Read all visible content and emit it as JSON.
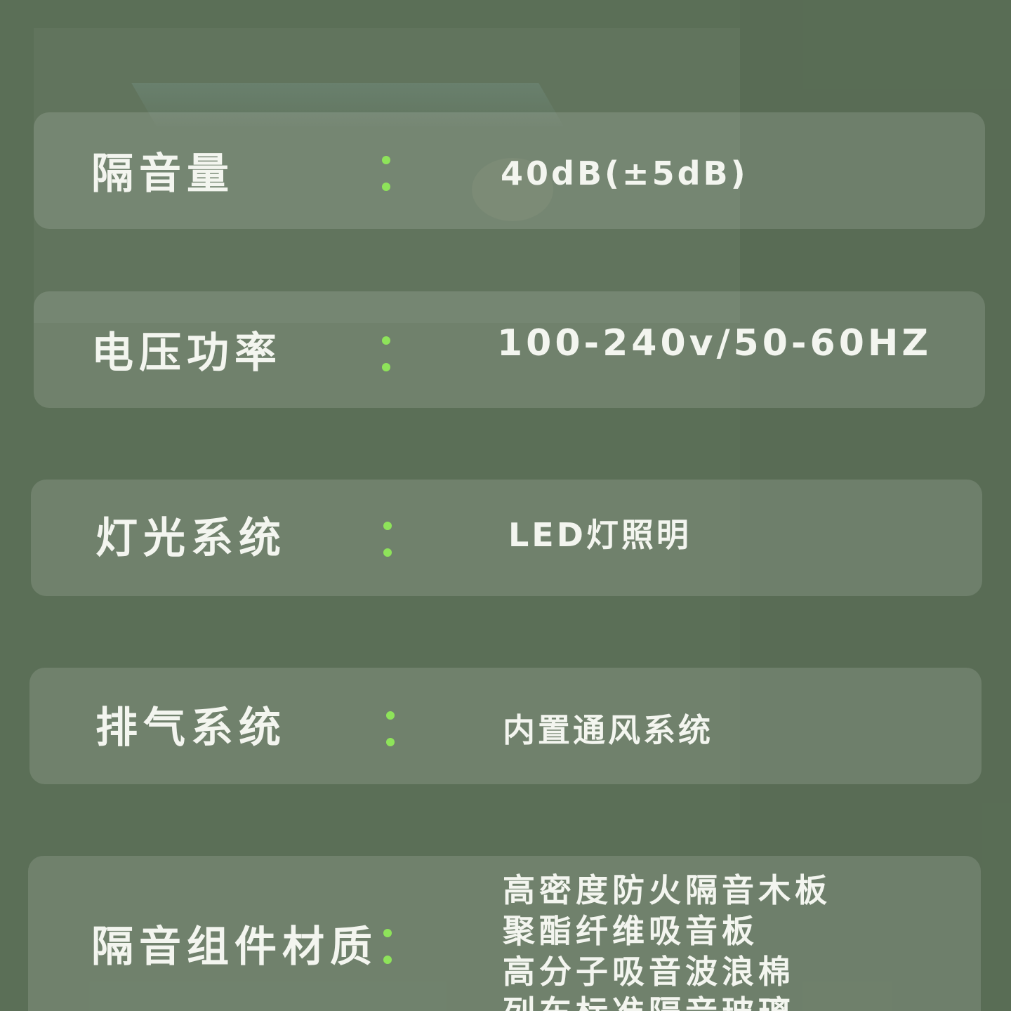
{
  "specs": [
    {
      "label": "隔音量",
      "value": "40dB(±5dB)"
    },
    {
      "label": "电压功率",
      "value": "100-240v/50-60HZ"
    },
    {
      "label": "灯光系统",
      "value": "LED灯照明"
    },
    {
      "label": "排气系统",
      "value": "内置通风系统"
    },
    {
      "label": "隔音组件材质",
      "value_lines": [
        "高密度防火隔音木板",
        "聚酯纤维吸音板",
        "高分子吸音波浪棉",
        "列车标准隔音玻璃"
      ]
    }
  ],
  "colors": {
    "background": "#5b6f57",
    "text": "#f3f5ef",
    "colon_accent": "#8ee35a"
  }
}
